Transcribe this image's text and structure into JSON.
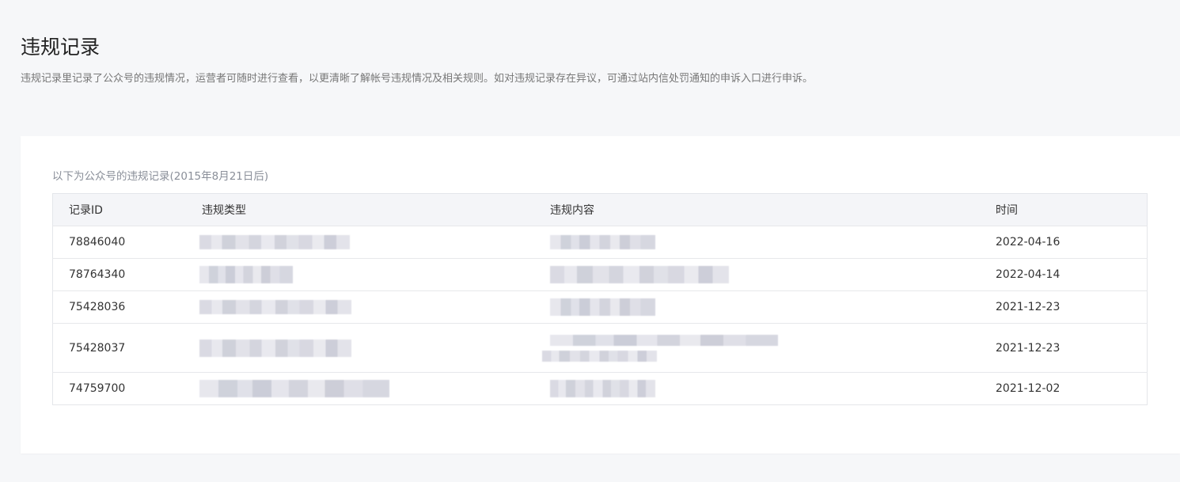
{
  "page": {
    "title": "违规记录",
    "description": "违规记录里记录了公众号的违规情况，运营者可随时进行查看，以更清晰了解帐号违规情况及相关规则。如对违规记录存在异议，可通过站内信处罚通知的申诉入口进行申诉。"
  },
  "table": {
    "caption": "以下为公众号的违规记录(2015年8月21日后)",
    "headers": [
      "记录ID",
      "违规类型",
      "违规内容",
      "时间"
    ],
    "rows": [
      {
        "id": "78846040",
        "type_redacted": true,
        "content_redacted": true,
        "date": "2022-04-16"
      },
      {
        "id": "78764340",
        "type_redacted": true,
        "content_redacted": true,
        "date": "2022-04-14"
      },
      {
        "id": "75428036",
        "type_redacted": true,
        "content_redacted": true,
        "date": "2021-12-23"
      },
      {
        "id": "75428037",
        "type_redacted": true,
        "content_redacted": true,
        "date": "2021-12-23"
      },
      {
        "id": "74759700",
        "type_redacted": true,
        "content_redacted": true,
        "date": "2021-12-02"
      }
    ]
  },
  "colors": {
    "page_bg": "#f6f7f9",
    "card_bg": "#ffffff",
    "header_bg": "#f4f5f8",
    "border": "#e7e8eb",
    "text_primary": "#333333",
    "text_secondary": "#777777"
  }
}
